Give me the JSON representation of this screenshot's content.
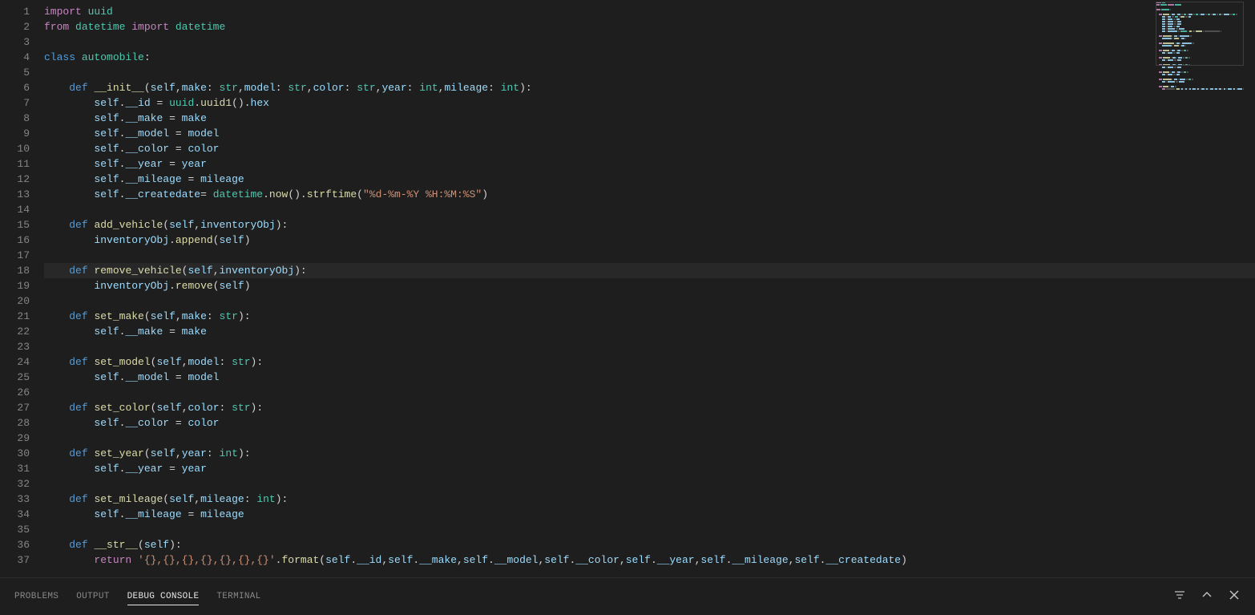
{
  "panel": {
    "tabs": [
      "PROBLEMS",
      "OUTPUT",
      "DEBUG CONSOLE",
      "TERMINAL"
    ],
    "active_index": 2
  },
  "gutter": {
    "start": 1,
    "end": 37
  },
  "highlighted_line": 18,
  "code_lines": [
    [
      {
        "t": "import ",
        "c": "tok-keyword"
      },
      {
        "t": "uuid",
        "c": "tok-module"
      }
    ],
    [
      {
        "t": "from ",
        "c": "tok-keyword"
      },
      {
        "t": "datetime",
        "c": "tok-module"
      },
      {
        "t": " import ",
        "c": "tok-keyword"
      },
      {
        "t": "datetime",
        "c": "tok-module"
      }
    ],
    [],
    [
      {
        "t": "class ",
        "c": "tok-keyword2"
      },
      {
        "t": "automobile",
        "c": "tok-class"
      },
      {
        "t": ":",
        "c": "tok-punct"
      }
    ],
    [],
    [
      {
        "t": "    ",
        "c": ""
      },
      {
        "t": "def ",
        "c": "tok-keyword2"
      },
      {
        "t": "__init__",
        "c": "tok-func"
      },
      {
        "t": "(",
        "c": "tok-punct"
      },
      {
        "t": "self",
        "c": "tok-self"
      },
      {
        "t": ",",
        "c": "tok-punct"
      },
      {
        "t": "make",
        "c": "tok-param"
      },
      {
        "t": ": ",
        "c": "tok-punct"
      },
      {
        "t": "str",
        "c": "tok-type"
      },
      {
        "t": ",",
        "c": "tok-punct"
      },
      {
        "t": "model",
        "c": "tok-param"
      },
      {
        "t": ": ",
        "c": "tok-punct"
      },
      {
        "t": "str",
        "c": "tok-type"
      },
      {
        "t": ",",
        "c": "tok-punct"
      },
      {
        "t": "color",
        "c": "tok-param"
      },
      {
        "t": ": ",
        "c": "tok-punct"
      },
      {
        "t": "str",
        "c": "tok-type"
      },
      {
        "t": ",",
        "c": "tok-punct"
      },
      {
        "t": "year",
        "c": "tok-param"
      },
      {
        "t": ": ",
        "c": "tok-punct"
      },
      {
        "t": "int",
        "c": "tok-type"
      },
      {
        "t": ",",
        "c": "tok-punct"
      },
      {
        "t": "mileage",
        "c": "tok-param"
      },
      {
        "t": ": ",
        "c": "tok-punct"
      },
      {
        "t": "int",
        "c": "tok-type"
      },
      {
        "t": "):",
        "c": "tok-punct"
      }
    ],
    [
      {
        "t": "        ",
        "c": ""
      },
      {
        "t": "self",
        "c": "tok-self"
      },
      {
        "t": ".",
        "c": "tok-punct"
      },
      {
        "t": "__id",
        "c": "tok-param"
      },
      {
        "t": " = ",
        "c": "tok-punct"
      },
      {
        "t": "uuid",
        "c": "tok-module"
      },
      {
        "t": ".",
        "c": "tok-punct"
      },
      {
        "t": "uuid1",
        "c": "tok-func"
      },
      {
        "t": "().",
        "c": "tok-punct"
      },
      {
        "t": "hex",
        "c": "tok-param"
      }
    ],
    [
      {
        "t": "        ",
        "c": ""
      },
      {
        "t": "self",
        "c": "tok-self"
      },
      {
        "t": ".",
        "c": "tok-punct"
      },
      {
        "t": "__make",
        "c": "tok-param"
      },
      {
        "t": " = ",
        "c": "tok-punct"
      },
      {
        "t": "make",
        "c": "tok-param"
      }
    ],
    [
      {
        "t": "        ",
        "c": ""
      },
      {
        "t": "self",
        "c": "tok-self"
      },
      {
        "t": ".",
        "c": "tok-punct"
      },
      {
        "t": "__model",
        "c": "tok-param"
      },
      {
        "t": " = ",
        "c": "tok-punct"
      },
      {
        "t": "model",
        "c": "tok-param"
      }
    ],
    [
      {
        "t": "        ",
        "c": ""
      },
      {
        "t": "self",
        "c": "tok-self"
      },
      {
        "t": ".",
        "c": "tok-punct"
      },
      {
        "t": "__color",
        "c": "tok-param"
      },
      {
        "t": " = ",
        "c": "tok-punct"
      },
      {
        "t": "color",
        "c": "tok-param"
      }
    ],
    [
      {
        "t": "        ",
        "c": ""
      },
      {
        "t": "self",
        "c": "tok-self"
      },
      {
        "t": ".",
        "c": "tok-punct"
      },
      {
        "t": "__year",
        "c": "tok-param"
      },
      {
        "t": " = ",
        "c": "tok-punct"
      },
      {
        "t": "year",
        "c": "tok-param"
      }
    ],
    [
      {
        "t": "        ",
        "c": ""
      },
      {
        "t": "self",
        "c": "tok-self"
      },
      {
        "t": ".",
        "c": "tok-punct"
      },
      {
        "t": "__mileage",
        "c": "tok-param"
      },
      {
        "t": " = ",
        "c": "tok-punct"
      },
      {
        "t": "mileage",
        "c": "tok-param"
      }
    ],
    [
      {
        "t": "        ",
        "c": ""
      },
      {
        "t": "self",
        "c": "tok-self"
      },
      {
        "t": ".",
        "c": "tok-punct"
      },
      {
        "t": "__createdate",
        "c": "tok-param"
      },
      {
        "t": "= ",
        "c": "tok-punct"
      },
      {
        "t": "datetime",
        "c": "tok-module"
      },
      {
        "t": ".",
        "c": "tok-punct"
      },
      {
        "t": "now",
        "c": "tok-func"
      },
      {
        "t": "().",
        "c": "tok-punct"
      },
      {
        "t": "strftime",
        "c": "tok-func"
      },
      {
        "t": "(",
        "c": "tok-punct"
      },
      {
        "t": "\"%d-%m-%Y %H:%M:%S\"",
        "c": "tok-string"
      },
      {
        "t": ")",
        "c": "tok-punct"
      }
    ],
    [],
    [
      {
        "t": "    ",
        "c": ""
      },
      {
        "t": "def ",
        "c": "tok-keyword2"
      },
      {
        "t": "add_vehicle",
        "c": "tok-func"
      },
      {
        "t": "(",
        "c": "tok-punct"
      },
      {
        "t": "self",
        "c": "tok-self"
      },
      {
        "t": ",",
        "c": "tok-punct"
      },
      {
        "t": "inventoryObj",
        "c": "tok-param"
      },
      {
        "t": "):",
        "c": "tok-punct"
      }
    ],
    [
      {
        "t": "        ",
        "c": ""
      },
      {
        "t": "inventoryObj",
        "c": "tok-param"
      },
      {
        "t": ".",
        "c": "tok-punct"
      },
      {
        "t": "append",
        "c": "tok-func"
      },
      {
        "t": "(",
        "c": "tok-punct"
      },
      {
        "t": "self",
        "c": "tok-self"
      },
      {
        "t": ")",
        "c": "tok-punct"
      }
    ],
    [],
    [
      {
        "t": "    ",
        "c": ""
      },
      {
        "t": "def ",
        "c": "tok-keyword2"
      },
      {
        "t": "remove_vehicle",
        "c": "tok-func"
      },
      {
        "t": "(",
        "c": "tok-punct"
      },
      {
        "t": "self",
        "c": "tok-self"
      },
      {
        "t": ",",
        "c": "tok-punct"
      },
      {
        "t": "inventoryObj",
        "c": "tok-param"
      },
      {
        "t": "):",
        "c": "tok-punct"
      }
    ],
    [
      {
        "t": "        ",
        "c": ""
      },
      {
        "t": "inventoryObj",
        "c": "tok-param"
      },
      {
        "t": ".",
        "c": "tok-punct"
      },
      {
        "t": "remove",
        "c": "tok-func"
      },
      {
        "t": "(",
        "c": "tok-punct"
      },
      {
        "t": "self",
        "c": "tok-self"
      },
      {
        "t": ")",
        "c": "tok-punct"
      }
    ],
    [],
    [
      {
        "t": "    ",
        "c": ""
      },
      {
        "t": "def ",
        "c": "tok-keyword2"
      },
      {
        "t": "set_make",
        "c": "tok-func"
      },
      {
        "t": "(",
        "c": "tok-punct"
      },
      {
        "t": "self",
        "c": "tok-self"
      },
      {
        "t": ",",
        "c": "tok-punct"
      },
      {
        "t": "make",
        "c": "tok-param"
      },
      {
        "t": ": ",
        "c": "tok-punct"
      },
      {
        "t": "str",
        "c": "tok-type"
      },
      {
        "t": "):",
        "c": "tok-punct"
      }
    ],
    [
      {
        "t": "        ",
        "c": ""
      },
      {
        "t": "self",
        "c": "tok-self"
      },
      {
        "t": ".",
        "c": "tok-punct"
      },
      {
        "t": "__make",
        "c": "tok-param"
      },
      {
        "t": " = ",
        "c": "tok-punct"
      },
      {
        "t": "make",
        "c": "tok-param"
      }
    ],
    [],
    [
      {
        "t": "    ",
        "c": ""
      },
      {
        "t": "def ",
        "c": "tok-keyword2"
      },
      {
        "t": "set_model",
        "c": "tok-func"
      },
      {
        "t": "(",
        "c": "tok-punct"
      },
      {
        "t": "self",
        "c": "tok-self"
      },
      {
        "t": ",",
        "c": "tok-punct"
      },
      {
        "t": "model",
        "c": "tok-param"
      },
      {
        "t": ": ",
        "c": "tok-punct"
      },
      {
        "t": "str",
        "c": "tok-type"
      },
      {
        "t": "):",
        "c": "tok-punct"
      }
    ],
    [
      {
        "t": "        ",
        "c": ""
      },
      {
        "t": "self",
        "c": "tok-self"
      },
      {
        "t": ".",
        "c": "tok-punct"
      },
      {
        "t": "__model",
        "c": "tok-param"
      },
      {
        "t": " = ",
        "c": "tok-punct"
      },
      {
        "t": "model",
        "c": "tok-param"
      }
    ],
    [],
    [
      {
        "t": "    ",
        "c": ""
      },
      {
        "t": "def ",
        "c": "tok-keyword2"
      },
      {
        "t": "set_color",
        "c": "tok-func"
      },
      {
        "t": "(",
        "c": "tok-punct"
      },
      {
        "t": "self",
        "c": "tok-self"
      },
      {
        "t": ",",
        "c": "tok-punct"
      },
      {
        "t": "color",
        "c": "tok-param"
      },
      {
        "t": ": ",
        "c": "tok-punct"
      },
      {
        "t": "str",
        "c": "tok-type"
      },
      {
        "t": "):",
        "c": "tok-punct"
      }
    ],
    [
      {
        "t": "        ",
        "c": ""
      },
      {
        "t": "self",
        "c": "tok-self"
      },
      {
        "t": ".",
        "c": "tok-punct"
      },
      {
        "t": "__color",
        "c": "tok-param"
      },
      {
        "t": " = ",
        "c": "tok-punct"
      },
      {
        "t": "color",
        "c": "tok-param"
      }
    ],
    [],
    [
      {
        "t": "    ",
        "c": ""
      },
      {
        "t": "def ",
        "c": "tok-keyword2"
      },
      {
        "t": "set_year",
        "c": "tok-func"
      },
      {
        "t": "(",
        "c": "tok-punct"
      },
      {
        "t": "self",
        "c": "tok-self"
      },
      {
        "t": ",",
        "c": "tok-punct"
      },
      {
        "t": "year",
        "c": "tok-param"
      },
      {
        "t": ": ",
        "c": "tok-punct"
      },
      {
        "t": "int",
        "c": "tok-type"
      },
      {
        "t": "):",
        "c": "tok-punct"
      }
    ],
    [
      {
        "t": "        ",
        "c": ""
      },
      {
        "t": "self",
        "c": "tok-self"
      },
      {
        "t": ".",
        "c": "tok-punct"
      },
      {
        "t": "__year",
        "c": "tok-param"
      },
      {
        "t": " = ",
        "c": "tok-punct"
      },
      {
        "t": "year",
        "c": "tok-param"
      }
    ],
    [],
    [
      {
        "t": "    ",
        "c": ""
      },
      {
        "t": "def ",
        "c": "tok-keyword2"
      },
      {
        "t": "set_mileage",
        "c": "tok-func"
      },
      {
        "t": "(",
        "c": "tok-punct"
      },
      {
        "t": "self",
        "c": "tok-self"
      },
      {
        "t": ",",
        "c": "tok-punct"
      },
      {
        "t": "mileage",
        "c": "tok-param"
      },
      {
        "t": ": ",
        "c": "tok-punct"
      },
      {
        "t": "int",
        "c": "tok-type"
      },
      {
        "t": "):",
        "c": "tok-punct"
      }
    ],
    [
      {
        "t": "        ",
        "c": ""
      },
      {
        "t": "self",
        "c": "tok-self"
      },
      {
        "t": ".",
        "c": "tok-punct"
      },
      {
        "t": "__mileage",
        "c": "tok-param"
      },
      {
        "t": " = ",
        "c": "tok-punct"
      },
      {
        "t": "mileage",
        "c": "tok-param"
      }
    ],
    [],
    [
      {
        "t": "    ",
        "c": ""
      },
      {
        "t": "def ",
        "c": "tok-keyword2"
      },
      {
        "t": "__str__",
        "c": "tok-func"
      },
      {
        "t": "(",
        "c": "tok-punct"
      },
      {
        "t": "self",
        "c": "tok-self"
      },
      {
        "t": "):",
        "c": "tok-punct"
      }
    ],
    [
      {
        "t": "        ",
        "c": ""
      },
      {
        "t": "return ",
        "c": "tok-keyword"
      },
      {
        "t": "'{},{},{},{},{},{},{}'",
        "c": "tok-string"
      },
      {
        "t": ".",
        "c": "tok-punct"
      },
      {
        "t": "format",
        "c": "tok-func"
      },
      {
        "t": "(",
        "c": "tok-punct"
      },
      {
        "t": "self",
        "c": "tok-self"
      },
      {
        "t": ".",
        "c": "tok-punct"
      },
      {
        "t": "__id",
        "c": "tok-param"
      },
      {
        "t": ",",
        "c": "tok-punct"
      },
      {
        "t": "self",
        "c": "tok-self"
      },
      {
        "t": ".",
        "c": "tok-punct"
      },
      {
        "t": "__make",
        "c": "tok-param"
      },
      {
        "t": ",",
        "c": "tok-punct"
      },
      {
        "t": "self",
        "c": "tok-self"
      },
      {
        "t": ".",
        "c": "tok-punct"
      },
      {
        "t": "__model",
        "c": "tok-param"
      },
      {
        "t": ",",
        "c": "tok-punct"
      },
      {
        "t": "self",
        "c": "tok-self"
      },
      {
        "t": ".",
        "c": "tok-punct"
      },
      {
        "t": "__color",
        "c": "tok-param"
      },
      {
        "t": ",",
        "c": "tok-punct"
      },
      {
        "t": "self",
        "c": "tok-self"
      },
      {
        "t": ".",
        "c": "tok-punct"
      },
      {
        "t": "__year",
        "c": "tok-param"
      },
      {
        "t": ",",
        "c": "tok-punct"
      },
      {
        "t": "self",
        "c": "tok-self"
      },
      {
        "t": ".",
        "c": "tok-punct"
      },
      {
        "t": "__mileage",
        "c": "tok-param"
      },
      {
        "t": ",",
        "c": "tok-punct"
      },
      {
        "t": "self",
        "c": "tok-self"
      },
      {
        "t": ".",
        "c": "tok-punct"
      },
      {
        "t": "__createdate",
        "c": "tok-param"
      },
      {
        "t": ")",
        "c": "tok-punct"
      }
    ]
  ]
}
